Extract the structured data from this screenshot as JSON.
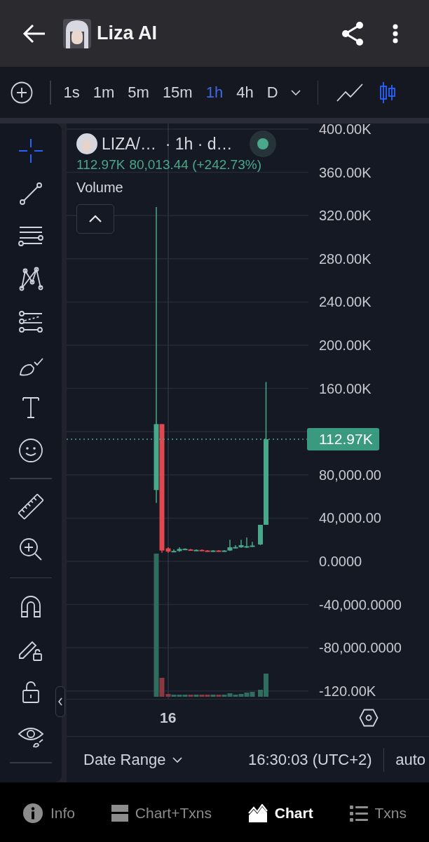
{
  "header": {
    "title": "Liza AI"
  },
  "toolbar": {
    "intervals": [
      {
        "label": "1s",
        "selected": false
      },
      {
        "label": "1m",
        "selected": false
      },
      {
        "label": "5m",
        "selected": false
      },
      {
        "label": "15m",
        "selected": false
      },
      {
        "label": "1h",
        "selected": true
      },
      {
        "label": "4h",
        "selected": false
      },
      {
        "label": "D",
        "selected": false
      }
    ],
    "chart_types": [
      {
        "selected": false
      },
      {
        "selected": true
      }
    ]
  },
  "drawing_tools": [
    {
      "selected": true
    },
    {
      "selected": false
    },
    {
      "selected": false
    },
    {
      "selected": false
    },
    {
      "selected": false
    },
    {
      "selected": false
    },
    {
      "selected": false
    },
    {
      "selected": false
    },
    {
      "selected": false
    },
    {
      "selected": false
    },
    {
      "selected": false
    },
    {
      "selected": false
    },
    {
      "selected": false
    },
    {
      "selected": false
    }
  ],
  "legend": {
    "symbol": "LIZA/…  · 1h · d…",
    "price": "112.97K",
    "change": "80,013.44 (+242.73%)",
    "volume_label": "Volume"
  },
  "price_axis": [
    {
      "kind": "tick",
      "label": "400.00K"
    },
    {
      "kind": "tick",
      "label": "360.00K"
    },
    {
      "kind": "tick",
      "label": "320.00K"
    },
    {
      "kind": "tick",
      "label": "280.00K"
    },
    {
      "kind": "tick",
      "label": "240.00K"
    },
    {
      "kind": "tick",
      "label": "200.00K"
    },
    {
      "kind": "tick",
      "label": "160.00K"
    },
    {
      "kind": "price",
      "label": "112.97K"
    },
    {
      "kind": "tick",
      "label": "80,000.00"
    },
    {
      "kind": "tick",
      "label": "40,000.00"
    },
    {
      "kind": "tick",
      "label": "0.0000"
    },
    {
      "kind": "tick",
      "label": "-40,000.0000"
    },
    {
      "kind": "tick",
      "label": "-80,000.0000"
    },
    {
      "kind": "tick",
      "label": "-120.00K"
    }
  ],
  "time_axis": {
    "label": "16"
  },
  "footer": {
    "date_range": "Date Range",
    "time": "16:30:03 (UTC+2)",
    "scale": "auto"
  },
  "bottom_nav": [
    {
      "label": "Info",
      "selected": false
    },
    {
      "label": "Chart+Txns",
      "selected": false
    },
    {
      "label": "Chart",
      "selected": true
    },
    {
      "label": "Txns",
      "selected": false
    }
  ]
}
